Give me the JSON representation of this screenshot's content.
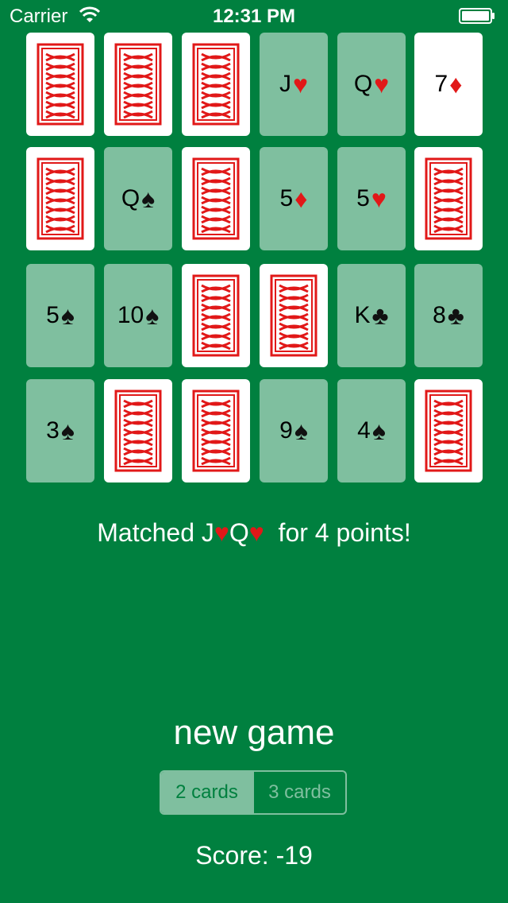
{
  "status_bar": {
    "carrier": "Carrier",
    "time": "12:31 PM"
  },
  "cards": [
    {
      "state": "back"
    },
    {
      "state": "back"
    },
    {
      "state": "back"
    },
    {
      "state": "matched",
      "rank": "J",
      "suit": "♥",
      "suit_color": "red"
    },
    {
      "state": "matched",
      "rank": "Q",
      "suit": "♥",
      "suit_color": "red"
    },
    {
      "state": "faceup",
      "rank": "7",
      "suit": "♦",
      "suit_color": "red"
    },
    {
      "state": "back"
    },
    {
      "state": "matched",
      "rank": "Q",
      "suit": "♠",
      "suit_color": "black"
    },
    {
      "state": "back"
    },
    {
      "state": "matched",
      "rank": "5",
      "suit": "♦",
      "suit_color": "red"
    },
    {
      "state": "matched",
      "rank": "5",
      "suit": "♥",
      "suit_color": "red"
    },
    {
      "state": "back"
    },
    {
      "state": "matched",
      "rank": "5",
      "suit": "♠",
      "suit_color": "black"
    },
    {
      "state": "matched",
      "rank": "10",
      "suit": "♠",
      "suit_color": "black"
    },
    {
      "state": "back"
    },
    {
      "state": "back"
    },
    {
      "state": "matched",
      "rank": "K",
      "suit": "♣",
      "suit_color": "black"
    },
    {
      "state": "matched",
      "rank": "8",
      "suit": "♣",
      "suit_color": "black"
    },
    {
      "state": "matched",
      "rank": "3",
      "suit": "♠",
      "suit_color": "black"
    },
    {
      "state": "back"
    },
    {
      "state": "back"
    },
    {
      "state": "matched",
      "rank": "9",
      "suit": "♠",
      "suit_color": "black"
    },
    {
      "state": "matched",
      "rank": "4",
      "suit": "♠",
      "suit_color": "black"
    },
    {
      "state": "back"
    }
  ],
  "message": {
    "prefix": "Matched ",
    "card1_rank": "J",
    "card1_suit": "♥",
    "card2_rank": "Q",
    "card2_suit": "♥",
    "suffix": "  for 4 points!"
  },
  "new_game_label": "new game",
  "mode": {
    "options": [
      "2 cards",
      "3 cards"
    ],
    "selected": "2 cards"
  },
  "score": "Score: -19",
  "colors": {
    "table_green": "#00803f",
    "matched_card": "#7fbf9f",
    "card_back_red": "#e11818"
  }
}
